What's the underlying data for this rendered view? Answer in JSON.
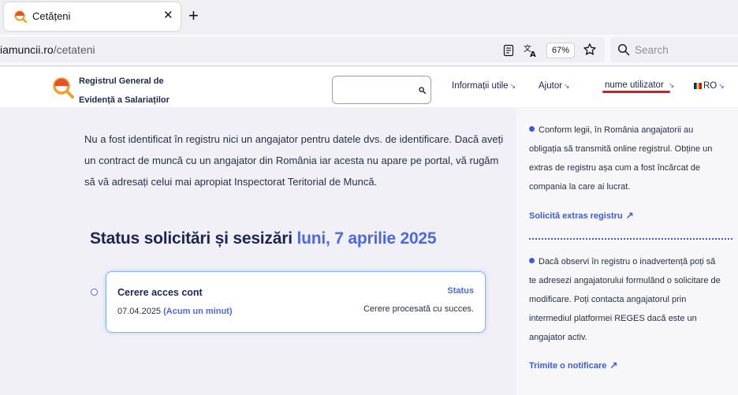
{
  "browser": {
    "tab_title": "Cetățeni",
    "tab_close_glyph": "✕",
    "new_tab_glyph": "+",
    "url_host": "iamuncii.ro",
    "url_path": "/cetateni",
    "zoom": "67%",
    "search_placeholder": "Search"
  },
  "site": {
    "name_line1": "Registrul General de",
    "name_line2": "Evidență a Salariaților",
    "nav": {
      "info": "Informații utile",
      "help": "Ajutor",
      "user": "nume utilizator",
      "lang": "RO",
      "arrow": "↘"
    },
    "accent_color": "#4d69e0",
    "underline_color": "#e0171f"
  },
  "main": {
    "intro": "Nu a fost identificat în registru nici un angajator pentru datele dvs. de identificare. Dacă aveți un contract de muncă cu un angajator din România iar acesta nu apare pe portal, vă rugăm să vă adresați celui mai apropiat Inspectorat Teritorial de Muncă.",
    "status_heading": "Status solicitări și sesizări",
    "status_date": "luni, 7 aprilie 2025",
    "request": {
      "title": "Cerere acces cont",
      "status_label": "Status",
      "date": "07.04.2025",
      "relative": "(Acum un minut)",
      "result": "Cerere procesată cu succes."
    }
  },
  "aside": {
    "block1_text": "Conform legii, în România angajatorii au obligația să transmită online registrul. Obține un extras de registru așa cum a fost încărcat de compania la care ai lucrat.",
    "block1_link": "Solicită extras registru",
    "block2_text": "Dacă observi în registru o inadvertență poți să te adresezi angajatorului formulând o solicitare de modificare. Poți contacta angajatorul prin intermediul platformei REGES dacă este un angajator activ.",
    "block2_link": "Trimite o notificare",
    "link_arrow": "↗"
  }
}
